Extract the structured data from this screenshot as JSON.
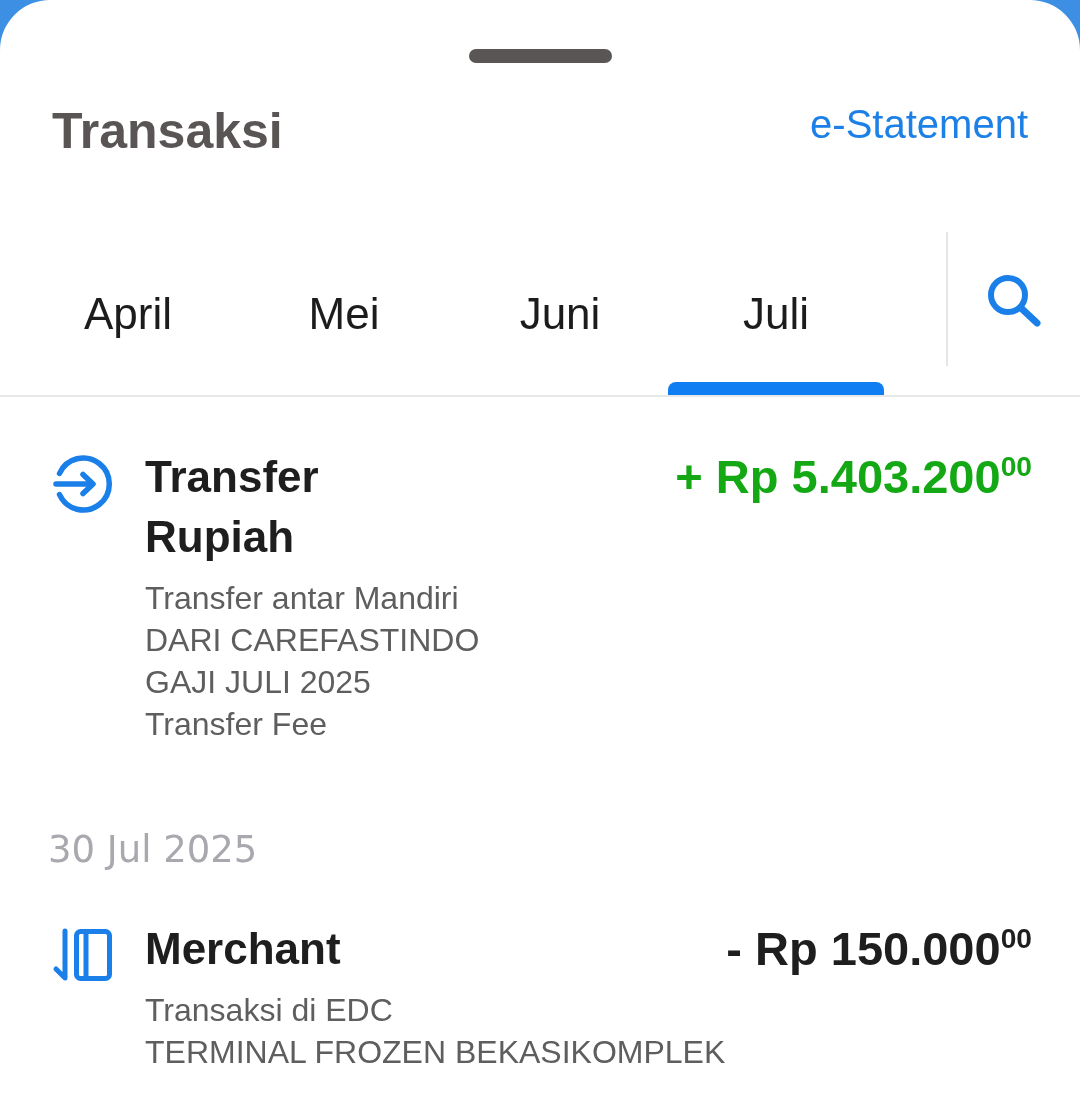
{
  "sheet": {
    "title": "Transaksi",
    "link": "e-Statement"
  },
  "tabs": [
    {
      "label": "April",
      "selected": false
    },
    {
      "label": "Mei",
      "selected": false
    },
    {
      "label": "Juni",
      "selected": false
    },
    {
      "label": "Juli",
      "selected": true
    }
  ],
  "items": [
    {
      "kind": "transfer",
      "title": "Transfer Rupiah",
      "amount": "+ Rp 5.403.200$^{00}$",
      "credit": true,
      "details": [
        "Transfer antar Mandiri",
        "DARI CAREFASTINDO",
        "GAJI JULI 2025",
        "Transfer Fee"
      ]
    },
    {
      "kind": "date",
      "label": "30 Jul 2025"
    },
    {
      "kind": "merchant",
      "title": "Merchant",
      "amount": "- Rp 150.000$^{00}$",
      "credit": false,
      "details": [
        "Transaksi di EDC",
        "TERMINAL FROZEN BEKASIKOMPLEK"
      ]
    }
  ]
}
